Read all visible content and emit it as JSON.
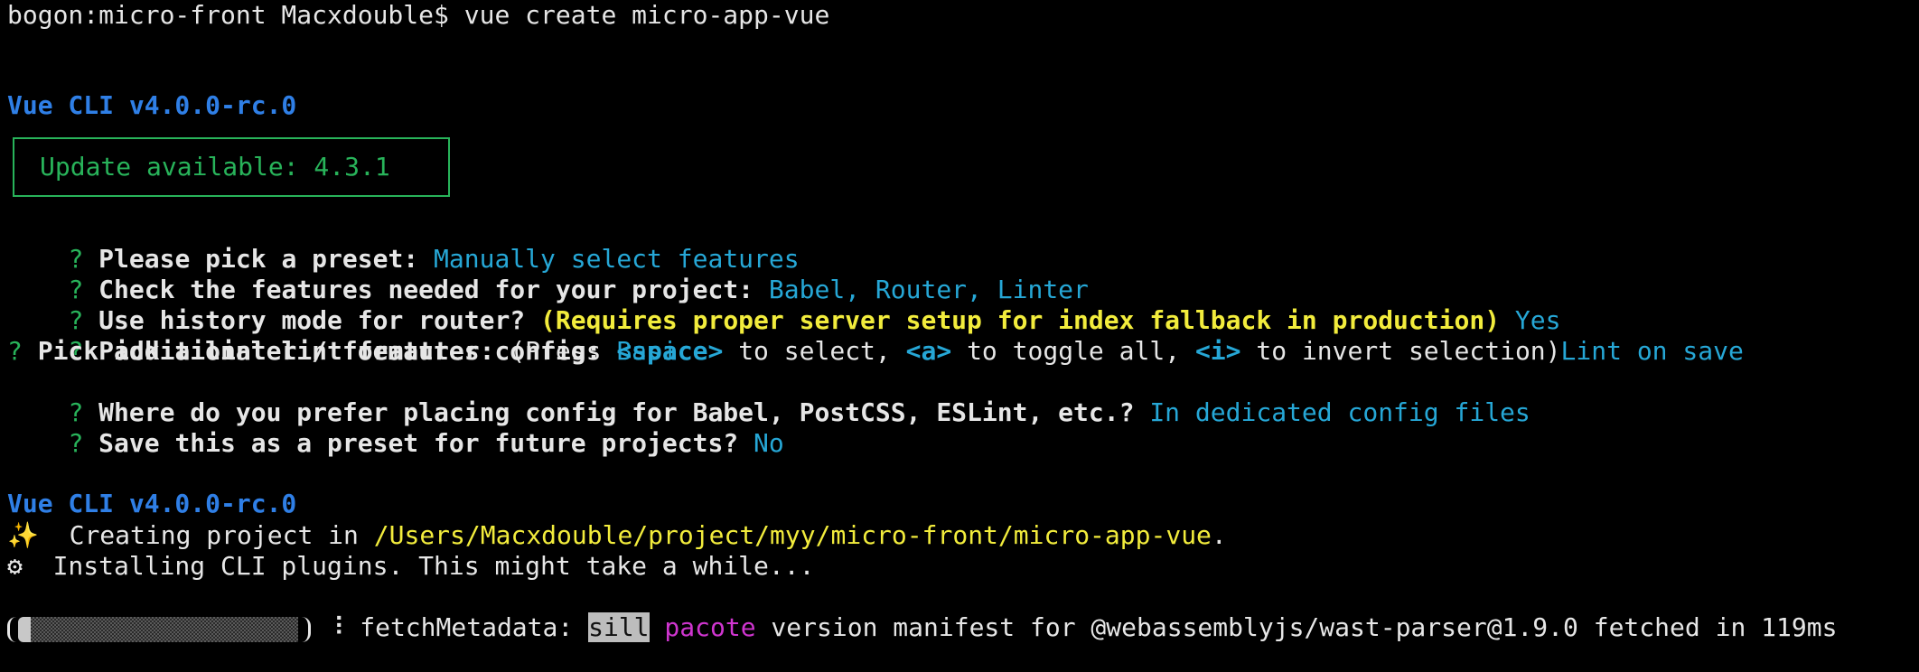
{
  "terminal": {
    "prompt_line": "bogon:micro-front Macxdouble$ vue create micro-app-vue",
    "cli_header_1": "Vue CLI v4.0.0-rc.0",
    "update_notice": "Update available: 4.3.1",
    "questions": [
      {
        "mark": "?",
        "question": "Please pick a preset:",
        "answer": "Manually select features"
      },
      {
        "mark": "?",
        "question": "Check the features needed for your project:",
        "answer": "Babel, Router, Linter"
      },
      {
        "mark": "?",
        "question": "Use history mode for router?",
        "note": "(Requires proper server setup for index fallback in production)",
        "answer": "Yes"
      },
      {
        "mark": "?",
        "question": "Pick a linter / formatter config:",
        "answer": "Basic"
      },
      {
        "mark": "?",
        "question": "Pick additional lint features:",
        "hint_1": "(Press ",
        "key_space": "<space>",
        "hint_2": " to select, ",
        "key_a": "<a>",
        "hint_3": " to toggle all, ",
        "key_i": "<i>",
        "hint_4": " to invert selection)",
        "answer": "Lint on save"
      },
      {
        "mark": "?",
        "question": "Where do you prefer placing config for Babel, PostCSS, ESLint, etc.?",
        "answer": "In dedicated config files"
      },
      {
        "mark": "?",
        "question": "Save this as a preset for future projects?",
        "answer": "No"
      }
    ],
    "cli_header_2": "Vue CLI v4.0.0-rc.0",
    "creating": {
      "icon": "sparkles-icon",
      "glyph": "✨",
      "text": "  Creating project in ",
      "path": "/Users/Macxdouble/project/myy/micro-front/micro-app-vue",
      "end": "."
    },
    "installing": {
      "icon": "gear-icon",
      "glyph": "⚙",
      "text": "  Installing CLI plugins. This might take a while..."
    },
    "progress": {
      "separator": " ⠸ ",
      "task": "fetchMetadata: ",
      "level": "sill",
      "source": "pacote",
      "message": " version manifest for @webassemblyjs/wast-parser@1.9.0 fetched in 119ms"
    }
  },
  "colors": {
    "background": "#000000",
    "text": "#e6e6e6",
    "vue_blue": "#2f7fe6",
    "answer_cyan": "#26a7d6",
    "update_green": "#28b35a",
    "yellow": "#f2ec3c",
    "magenta": "#cf35cf"
  }
}
